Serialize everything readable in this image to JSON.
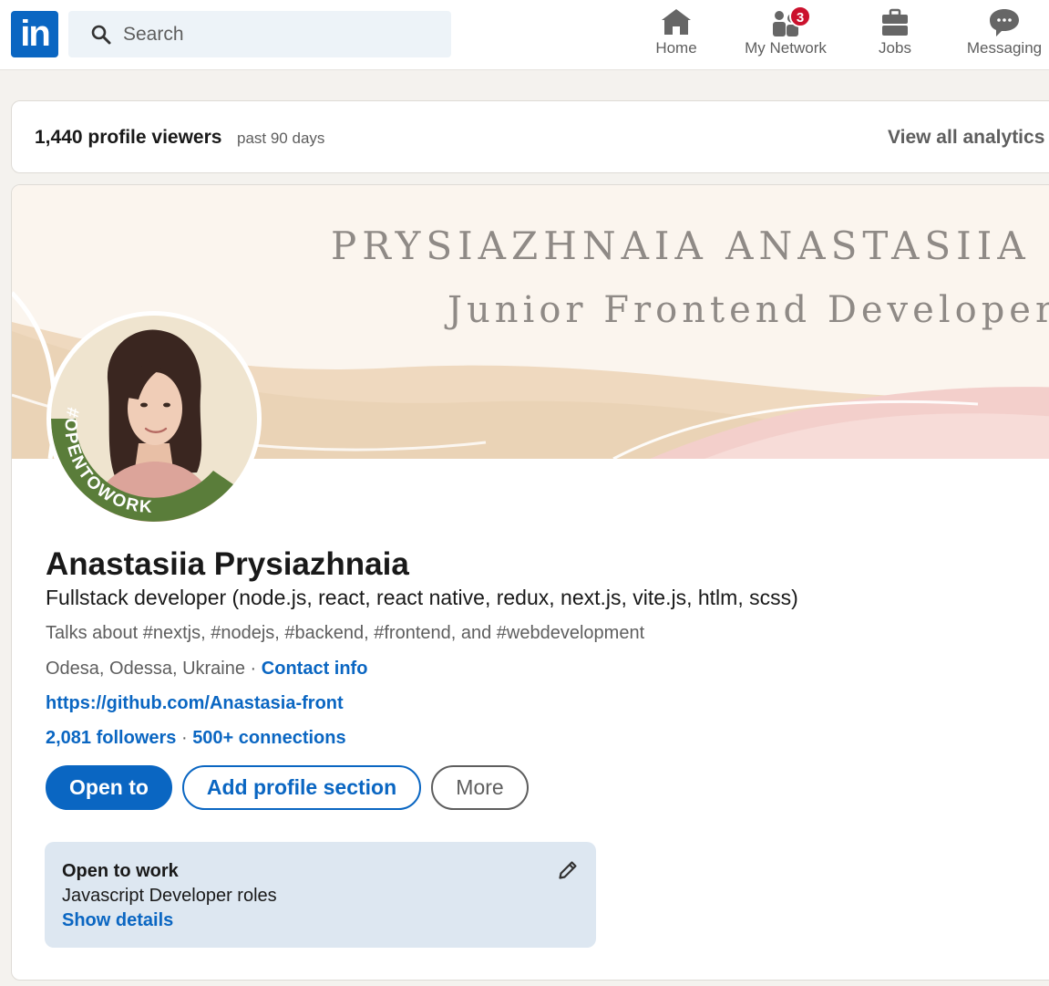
{
  "nav": {
    "logo_text": "in",
    "search_placeholder": "Search",
    "items": [
      {
        "label": "Home",
        "icon": "home-icon"
      },
      {
        "label": "My Network",
        "icon": "network-icon",
        "badge": "3"
      },
      {
        "label": "Jobs",
        "icon": "briefcase-icon"
      },
      {
        "label": "Messaging",
        "icon": "message-icon"
      }
    ]
  },
  "analytics": {
    "viewers": "1,440 profile viewers",
    "period": "past 90 days",
    "view_all": "View all analytics"
  },
  "banner": {
    "name": "PRYSIAZHNAIA ANASTASIIA",
    "role": "Junior Frontend Developer"
  },
  "avatar": {
    "ring_text": "#OPENTOWORK",
    "ring_color": "#5a7d3a"
  },
  "profile": {
    "name": "Anastasiia Prysiazhnaia",
    "headline": "Fullstack developer (node.js, react, react native, redux, next.js, vite.js, htlm, scss)",
    "talks": "Talks about #nextjs, #nodejs, #backend, #frontend, and #webdevelopment",
    "location": "Odesa, Odessa, Ukraine",
    "separator": " · ",
    "contact": "Contact info",
    "website": "https://github.com/Anastasia-front",
    "followers": "2,081 followers",
    "stats_sep": "  · ",
    "connections": "500+ connections"
  },
  "actions": {
    "open_to": "Open to",
    "add_section": "Add profile section",
    "more": "More"
  },
  "open_to_work": {
    "title": "Open to work",
    "roles": "Javascript Developer roles",
    "show_details": "Show details"
  },
  "colors": {
    "brand": "#0a66c2",
    "badge": "#cb112d",
    "otw_bg": "#dde7f1"
  }
}
